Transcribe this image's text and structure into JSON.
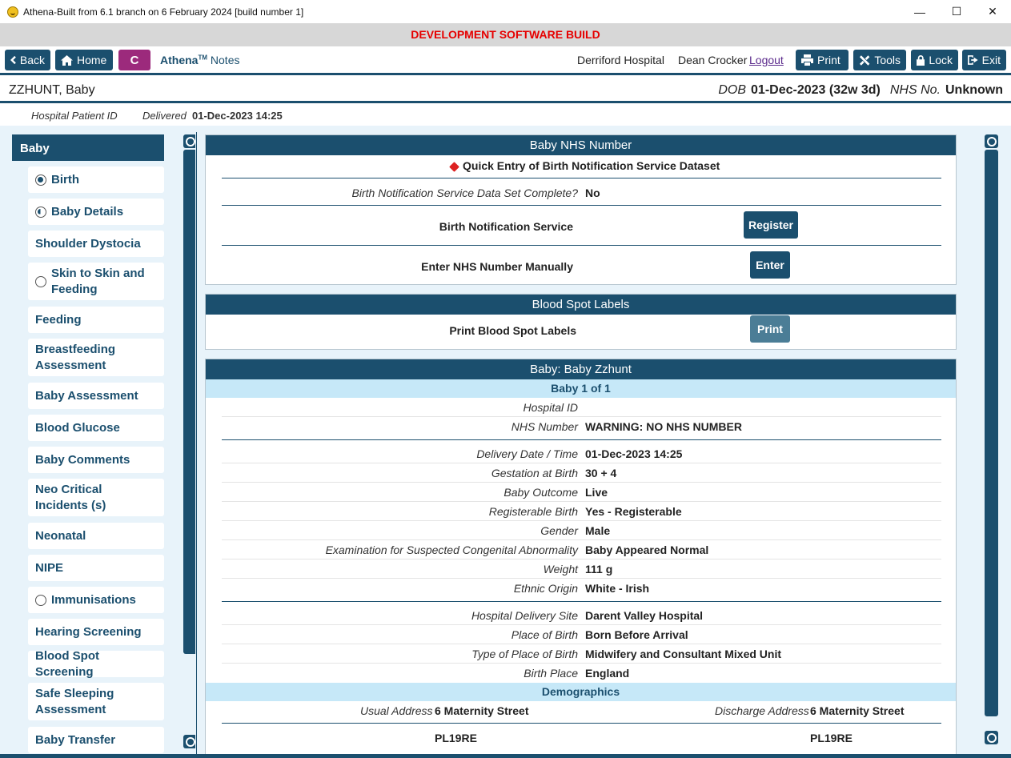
{
  "window": {
    "title": "Athena-Built from 6.1 branch on 6 February 2024 [build number 1]",
    "controls": [
      "—",
      "☐",
      "✕"
    ]
  },
  "banner": "DEVELOPMENT SOFTWARE BUILD",
  "nav": {
    "back": "Back",
    "home": "Home",
    "c_button": "C",
    "brand": "Athena",
    "tm": "TM",
    "notes": "Notes",
    "hospital": "Derriford Hospital",
    "user": "Dean Crocker",
    "logout": "Logout",
    "print": "Print",
    "tools": "Tools",
    "lock": "Lock",
    "exit": "Exit",
    "accent": "#1b4f6e"
  },
  "patient": {
    "name": "ZZHUNT, Baby",
    "dob_label": "DOB",
    "dob_value": "01-Dec-2023 (32w 3d)",
    "nhs_label": "NHS No.",
    "nhs_value": "Unknown",
    "hospital_id_label": "Hospital Patient ID",
    "delivered_label": "Delivered",
    "delivered_value": "01-Dec-2023 14:25"
  },
  "sidebar": {
    "header": "Baby",
    "items": [
      {
        "label": "Birth",
        "icon": "radio-full"
      },
      {
        "label": "Baby Details",
        "icon": "radio-half"
      },
      {
        "label": "Shoulder Dystocia",
        "icon": ""
      },
      {
        "label": "Skin to Skin and Feeding",
        "icon": "radio-empty"
      },
      {
        "label": "Feeding",
        "icon": ""
      },
      {
        "label": "Breastfeeding Assessment",
        "icon": ""
      },
      {
        "label": "Baby Assessment",
        "icon": ""
      },
      {
        "label": "Blood Glucose",
        "icon": ""
      },
      {
        "label": "Baby Comments",
        "icon": ""
      },
      {
        "label": "Neo Critical Incidents (s)",
        "icon": ""
      },
      {
        "label": "Neonatal",
        "icon": ""
      },
      {
        "label": "NIPE",
        "icon": ""
      },
      {
        "label": "Immunisations",
        "icon": "radio-empty"
      },
      {
        "label": "Hearing Screening",
        "icon": ""
      },
      {
        "label": "Blood Spot Screening",
        "icon": ""
      },
      {
        "label": "Safe Sleeping Assessment",
        "icon": ""
      },
      {
        "label": "Baby Transfer",
        "icon": ""
      }
    ]
  },
  "nhs_panel": {
    "title": "Baby NHS Number",
    "quick_entry": "Quick Entry of Birth Notification Service Dataset",
    "complete_label": "Birth Notification Service Data Set Complete?",
    "complete_value": "No",
    "bns_label": "Birth Notification Service",
    "register_button": "Register",
    "manual_label": "Enter NHS Number Manually",
    "enter_button": "Enter"
  },
  "blood_spot_panel": {
    "title": "Blood Spot Labels",
    "label": "Print Blood Spot Labels",
    "print_button": "Print"
  },
  "baby_panel": {
    "title": "Baby: Baby Zzhunt",
    "subtitle": "Baby 1 of  1",
    "rows": [
      {
        "label": "Hospital ID",
        "value": ""
      },
      {
        "label": "NHS Number",
        "value": "WARNING: NO NHS NUMBER"
      },
      {
        "label": "Delivery Date / Time",
        "value": "01-Dec-2023 14:25"
      },
      {
        "label": "Gestation at Birth",
        "value": "30 + 4"
      },
      {
        "label": "Baby Outcome",
        "value": "Live"
      },
      {
        "label": "Registerable Birth",
        "value": "Yes - Registerable"
      },
      {
        "label": "Gender",
        "value": "Male"
      },
      {
        "label": "Examination for Suspected Congenital Abnormality",
        "value": "Baby Appeared Normal"
      },
      {
        "label": "Weight",
        "value": "111 g"
      },
      {
        "label": "Ethnic Origin",
        "value": "White - Irish"
      },
      {
        "label": "Hospital Delivery Site",
        "value": "Darent Valley Hospital"
      },
      {
        "label": "Place of Birth",
        "value": "Born Before Arrival"
      },
      {
        "label": "Type of Place of Birth",
        "value": "Midwifery and Consultant Mixed Unit"
      },
      {
        "label": "Birth Place",
        "value": "England"
      }
    ],
    "demographics": {
      "title": "Demographics",
      "usual_label": "Usual Address",
      "usual_line1": "6 Maternity Street",
      "usual_line2": "PL19RE",
      "discharge_label": "Discharge Address",
      "discharge_line1": "6 Maternity Street",
      "discharge_line2": "PL19RE"
    }
  }
}
